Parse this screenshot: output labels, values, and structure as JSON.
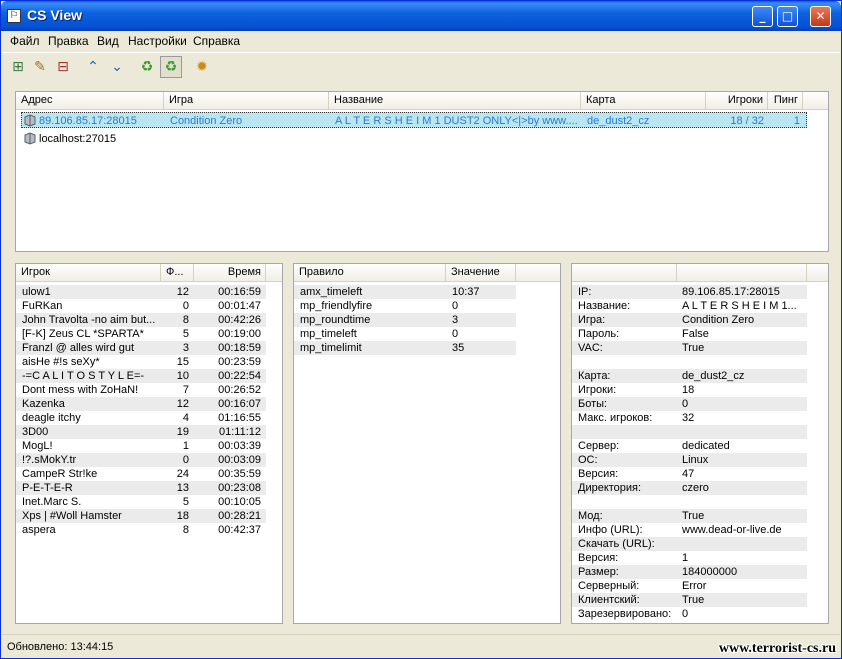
{
  "window": {
    "title": "CS View"
  },
  "menu": [
    "Файл",
    "Правка",
    "Вид",
    "Настройки",
    "Справка"
  ],
  "toolbar": [
    {
      "name": "server-add-icon",
      "glyph": "⊞"
    },
    {
      "name": "server-edit-icon",
      "glyph": "✎"
    },
    {
      "name": "server-remove-icon",
      "glyph": "⊟"
    },
    {
      "name": "move-up-icon",
      "glyph": "⌃"
    },
    {
      "name": "move-down-icon",
      "glyph": "⌄"
    },
    {
      "name": "refresh-icon",
      "glyph": "♻"
    },
    {
      "name": "auto-refresh-icon",
      "glyph": "♻"
    },
    {
      "name": "settings-icon",
      "glyph": "✹"
    }
  ],
  "servers": {
    "columns": [
      "Адрес",
      "Игра",
      "Название",
      "Карта",
      "Игроки",
      "Пинг"
    ],
    "rows": [
      {
        "address": "89.106.85.17:28015",
        "game": "Condition Zero",
        "name": "A L T E R S H E I M  1 DUST2 ONLY<|>by www....",
        "map": "de_dust2_cz",
        "players": "18 / 32",
        "ping": "1"
      },
      {
        "address": "localhost:27015",
        "game": "",
        "name": "",
        "map": "",
        "players": "",
        "ping": ""
      }
    ]
  },
  "players": {
    "columns": [
      "Игрок",
      "Ф...",
      "Время"
    ],
    "rows": [
      {
        "name": "ulow1",
        "frags": "12",
        "time": "00:16:59"
      },
      {
        "name": "FuRKan",
        "frags": "0",
        "time": "00:01:47"
      },
      {
        "name": "John Travolta -no aim but...",
        "frags": "8",
        "time": "00:42:26"
      },
      {
        "name": "[F-K] Zeus CL *SPARTA*",
        "frags": "5",
        "time": "00:19:00"
      },
      {
        "name": "Franzl @ alles wird gut",
        "frags": "3",
        "time": "00:18:59"
      },
      {
        "name": "aisHe #!s seXy*",
        "frags": "15",
        "time": "00:23:59"
      },
      {
        "name": "-=C A L I T O S T Y L E=-",
        "frags": "10",
        "time": "00:22:54"
      },
      {
        "name": "Dont mess with ZoHaN!",
        "frags": "7",
        "time": "00:26:52"
      },
      {
        "name": "Kazenka",
        "frags": "12",
        "time": "00:16:07"
      },
      {
        "name": "deagle itchy",
        "frags": "4",
        "time": "01:16:55"
      },
      {
        "name": "3D00",
        "frags": "19",
        "time": "01:11:12"
      },
      {
        "name": "MogL!",
        "frags": "1",
        "time": "00:03:39"
      },
      {
        "name": "!?.sMokY.tr",
        "frags": "0",
        "time": "00:03:09"
      },
      {
        "name": "CampeR Str!ke",
        "frags": "24",
        "time": "00:35:59"
      },
      {
        "name": "P-E-T-E-R",
        "frags": "13",
        "time": "00:23:08"
      },
      {
        "name": "Inet.Marc S.",
        "frags": "5",
        "time": "00:10:05"
      },
      {
        "name": "Xps | #Woll Hamster",
        "frags": "18",
        "time": "00:28:21"
      },
      {
        "name": "aspera",
        "frags": "8",
        "time": "00:42:37"
      }
    ]
  },
  "rules": {
    "columns": [
      "Правило",
      "Значение"
    ],
    "rows": [
      {
        "rule": "amx_timeleft",
        "value": "10:37"
      },
      {
        "rule": "mp_friendlyfire",
        "value": "0"
      },
      {
        "rule": "mp_roundtime",
        "value": "3"
      },
      {
        "rule": "mp_timeleft",
        "value": "0"
      },
      {
        "rule": "mp_timelimit",
        "value": "35"
      }
    ]
  },
  "info": {
    "rows": [
      {
        "key": "IP:",
        "value": "89.106.85.17:28015"
      },
      {
        "key": "Название:",
        "value": "A L T E R S H E I M 1..."
      },
      {
        "key": "Игра:",
        "value": "Condition Zero"
      },
      {
        "key": "Пароль:",
        "value": "False"
      },
      {
        "key": "VAC:",
        "value": "True"
      },
      {
        "key": "",
        "value": ""
      },
      {
        "key": "Карта:",
        "value": "de_dust2_cz"
      },
      {
        "key": "Игроки:",
        "value": "18"
      },
      {
        "key": "Боты:",
        "value": "0"
      },
      {
        "key": "Макс. игроков:",
        "value": "32"
      },
      {
        "key": "",
        "value": ""
      },
      {
        "key": "Сервер:",
        "value": "dedicated"
      },
      {
        "key": "ОС:",
        "value": "Linux"
      },
      {
        "key": "Версия:",
        "value": "47"
      },
      {
        "key": "Директория:",
        "value": "czero"
      },
      {
        "key": "",
        "value": ""
      },
      {
        "key": "Мод:",
        "value": "True"
      },
      {
        "key": "Инфо (URL):",
        "value": "www.dead-or-live.de"
      },
      {
        "key": "Скачать (URL):",
        "value": ""
      },
      {
        "key": "Версия:",
        "value": "1"
      },
      {
        "key": "Размер:",
        "value": "184000000"
      },
      {
        "key": "Серверный:",
        "value": "Error"
      },
      {
        "key": "Клиентский:",
        "value": "True"
      },
      {
        "key": "Зарезервировано:",
        "value": "0"
      }
    ]
  },
  "status": {
    "text": "Обновлено: 13:44:15"
  },
  "watermark": "www.terrorist-cs.ru"
}
